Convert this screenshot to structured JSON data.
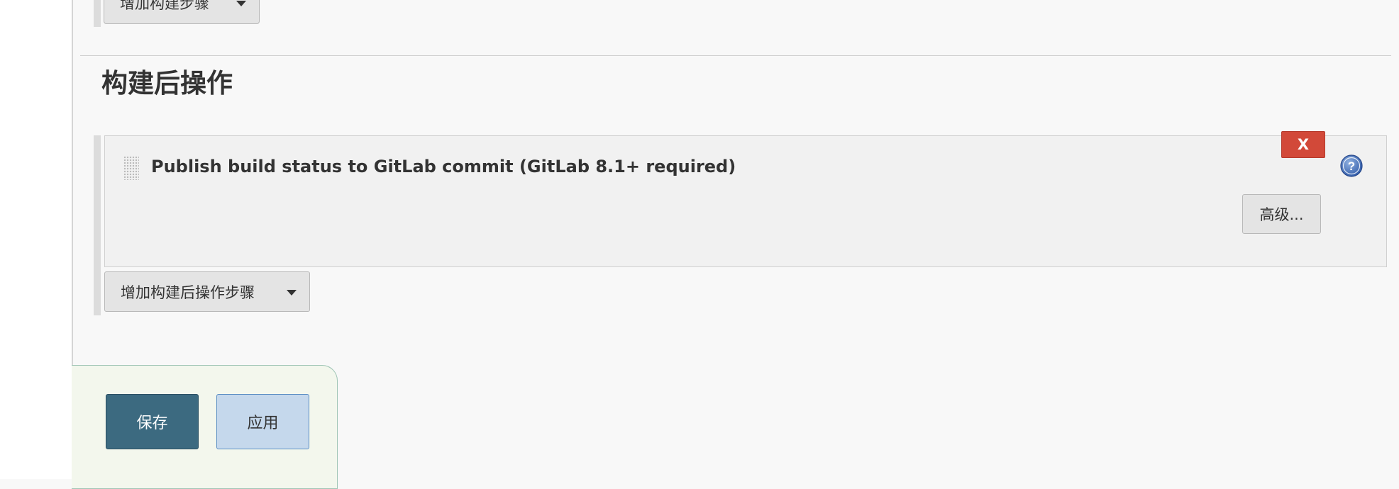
{
  "build": {
    "add_step_label": "增加构建步骤"
  },
  "post_build": {
    "section_title": "构建后操作",
    "step": {
      "title": "Publish build status to GitLab commit (GitLab 8.1+ required)",
      "delete_label": "X",
      "help_label": "?",
      "advanced_label": "高级..."
    },
    "add_step_label": "增加构建后操作步骤"
  },
  "footer": {
    "save_label": "保存",
    "apply_label": "应用"
  },
  "colors": {
    "delete": "#d24939",
    "save": "#3c6a80",
    "apply": "#c5d8ec",
    "help": "#4a6fb5",
    "background": "#f8f8f8"
  },
  "icons": {
    "dropdown": "caret-down-icon",
    "drag": "drag-handle-icon",
    "help": "help-icon"
  }
}
